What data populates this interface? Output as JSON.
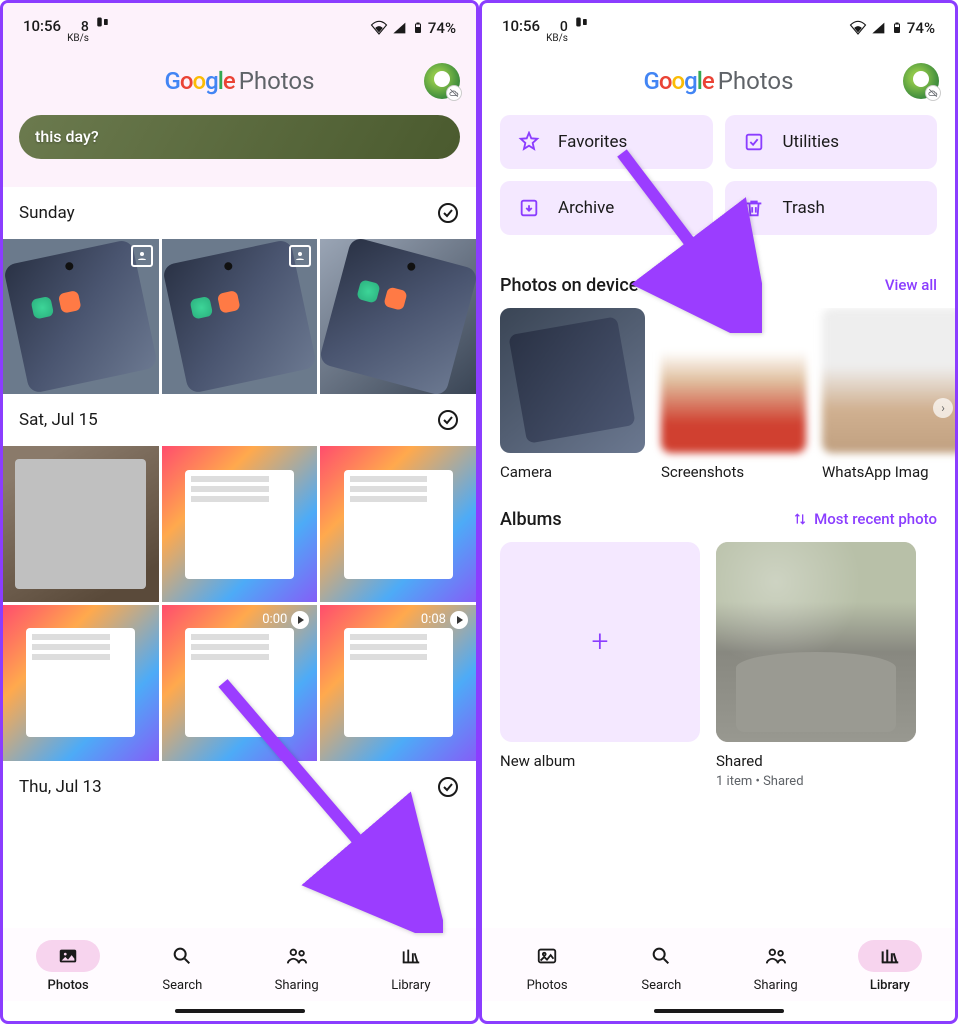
{
  "status": {
    "time": "10:56",
    "speed_left_num": "8",
    "speed_right_num": "0",
    "speed_unit": "KB/s",
    "battery": "74%"
  },
  "logo": {
    "word1": "Google",
    "word2": "Photos"
  },
  "left": {
    "chip": "this day?",
    "dates": {
      "d1": "Sunday",
      "d2": "Sat, Jul 15",
      "d3": "Thu, Jul 13"
    },
    "videos": {
      "v1": "0:00",
      "v2": "0:08"
    }
  },
  "right": {
    "buttons": {
      "fav": "Favorites",
      "util": "Utilities",
      "arch": "Archive",
      "trash": "Trash"
    },
    "sections": {
      "device": "Photos on device",
      "device_action": "View all",
      "albums": "Albums",
      "albums_action": "Most recent photo"
    },
    "device_folders": {
      "camera": "Camera",
      "screenshots": "Screenshots",
      "whatsapp": "WhatsApp Imag"
    },
    "albums": {
      "new": "New album",
      "shared": "Shared",
      "shared_meta": "1 item  •  Shared"
    }
  },
  "nav": {
    "photos": "Photos",
    "search": "Search",
    "sharing": "Sharing",
    "library": "Library"
  }
}
